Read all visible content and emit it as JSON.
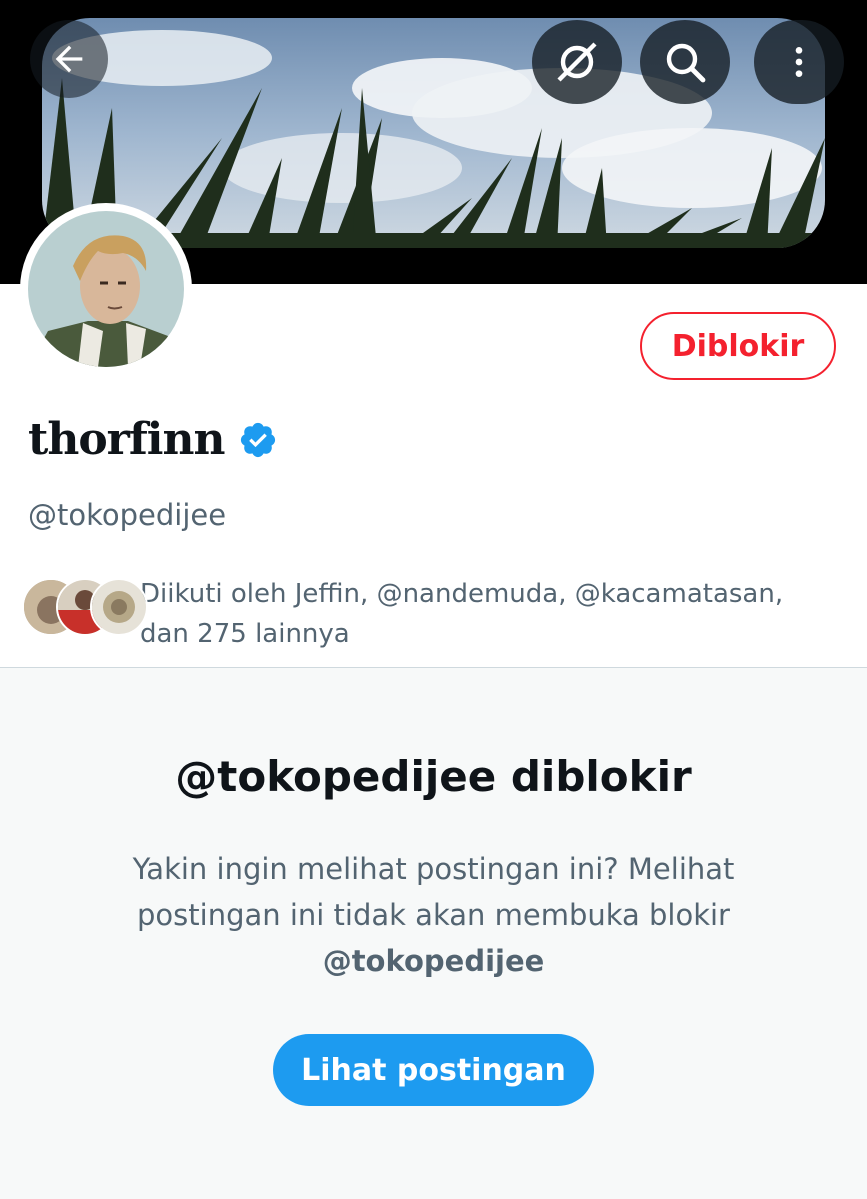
{
  "header": {
    "back_icon": "arrow-left-icon",
    "grok_icon": "grok-icon",
    "search_icon": "search-icon",
    "more_icon": "more-vertical-icon"
  },
  "profile": {
    "display_name": "thorfinn",
    "verified": true,
    "handle": "@tokopedijee",
    "blocked_button_label": "Diblokir",
    "followed_by_text": "Diikuti oleh Jeffin, @nandemuda, @kacamatasan, dan 275 lainnya"
  },
  "blocked_notice": {
    "title": "@tokopedijee diblokir",
    "description": "Yakin ingin melihat postingan ini? Melihat postingan ini tidak akan membuka blokir",
    "handle": "@tokopedijee",
    "view_button_label": "Lihat postingan"
  },
  "colors": {
    "accent": "#1d9bf0",
    "blocked_red": "#f4212e",
    "text_primary": "#0f1419",
    "text_secondary": "#536471"
  }
}
